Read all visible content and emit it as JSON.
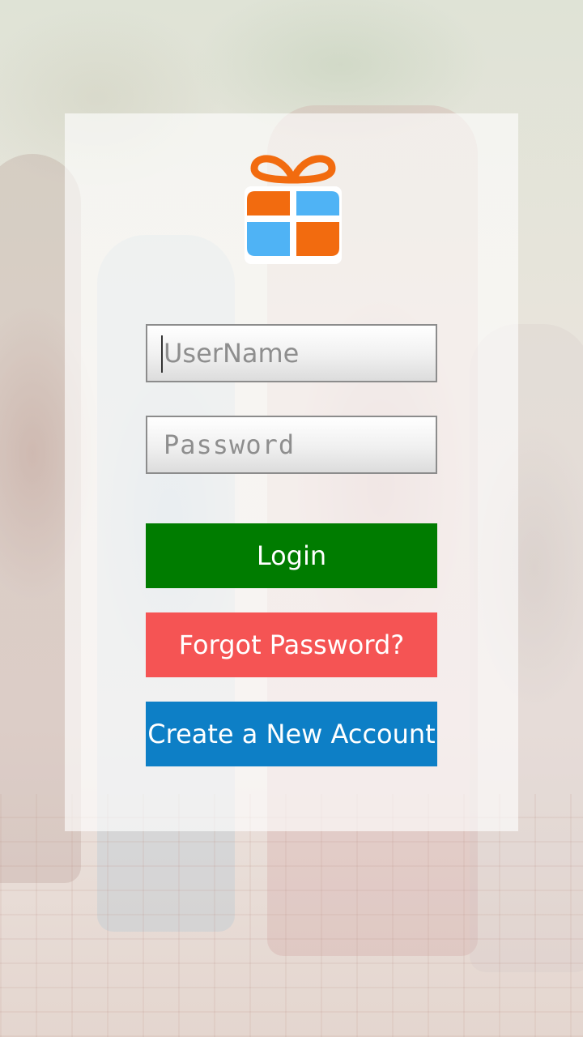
{
  "login_form": {
    "username_placeholder": "UserName",
    "password_placeholder": "Password",
    "login_label": "Login",
    "forgot_label": "Forgot Password?",
    "create_label": "Create a New Account"
  },
  "logo": {
    "icon": "gift-icon",
    "colors": {
      "orange": "#f26b0f",
      "blue": "#4fb3f5"
    }
  },
  "colors": {
    "login_button": "#007c00",
    "forgot_button": "#f55454",
    "create_button": "#0d7fc6"
  }
}
